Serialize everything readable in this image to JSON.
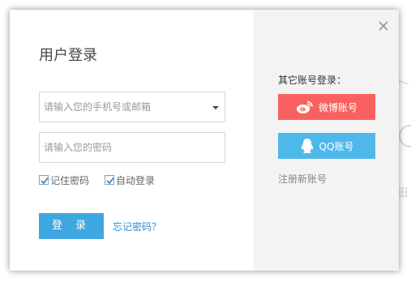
{
  "dialog": {
    "title": "用户登录",
    "close_icon": "close-icon"
  },
  "form": {
    "account_placeholder": "请输入您的手机号或邮箱",
    "account_value": "",
    "password_placeholder": "请输入您的密码",
    "password_value": "",
    "remember_label": "记住密码",
    "remember_checked": true,
    "auto_login_label": "自动登录",
    "auto_login_checked": true,
    "login_button": "登 录",
    "forgot_link": "忘记密码？"
  },
  "social": {
    "label": "其它账号登录：",
    "weibo_button": "微博账号",
    "qq_button": "QQ账号",
    "register_link": "注册新账号"
  },
  "colors": {
    "primary": "#3fa7e0",
    "weibo": "#f8615f",
    "qq": "#4fb8ea",
    "right_panel_bg": "#f3f3f3"
  }
}
